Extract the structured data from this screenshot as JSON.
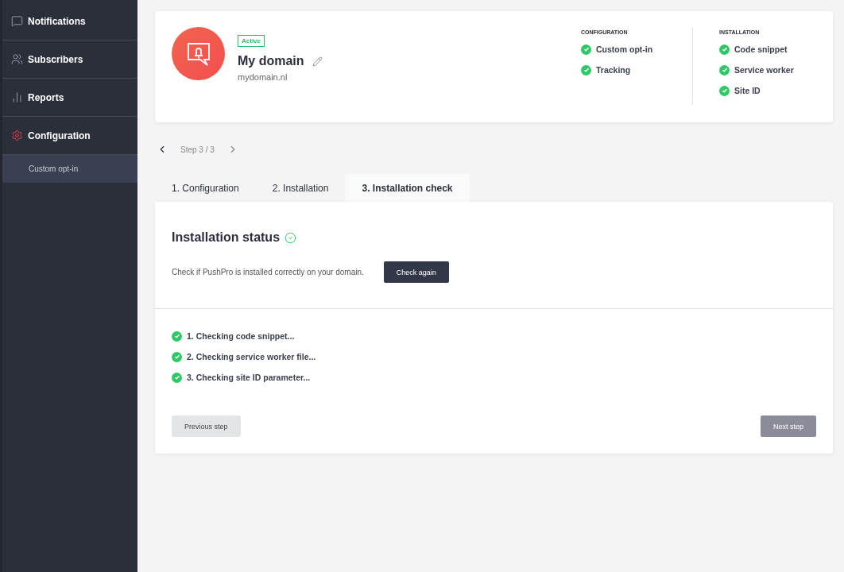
{
  "sidebar": {
    "items": [
      {
        "label": "Notifications",
        "kind": "message",
        "selected": false
      },
      {
        "label": "Subscribers",
        "kind": "users",
        "selected": false
      },
      {
        "label": "Reports",
        "kind": "chart",
        "selected": false
      },
      {
        "label": "Configuration",
        "kind": "gear",
        "selected": true,
        "children": [
          {
            "label": "Custom opt-in",
            "selected": true
          }
        ]
      }
    ]
  },
  "domain": {
    "status": "Active",
    "name": "My domain",
    "url": "mydomain.nl",
    "summary": [
      {
        "heading": "CONFIGURATION",
        "items": [
          {
            "label": "Custom opt-in",
            "checked": true
          },
          {
            "label": "Tracking",
            "checked": true
          }
        ]
      },
      {
        "heading": "INSTALLATION",
        "items": [
          {
            "label": "Code snippet",
            "checked": true
          },
          {
            "label": "Service worker",
            "checked": true
          },
          {
            "label": "Site ID",
            "checked": true
          }
        ]
      }
    ]
  },
  "stepper": {
    "label": "Step 3 / 3"
  },
  "tabs": [
    {
      "label": "1. Configuration",
      "selected": false
    },
    {
      "label": "2. Installation",
      "selected": false
    },
    {
      "label": "3. Installation check",
      "selected": true
    }
  ],
  "status": {
    "title": "Installation status",
    "ok": true,
    "description": "Check if PushPro is installed correctly on your domain.",
    "button": "Check again",
    "checks": [
      {
        "label": "1. Checking code snippet...",
        "checked": true
      },
      {
        "label": "2. Checking service worker file...",
        "checked": true
      },
      {
        "label": "3. Checking site ID parameter...",
        "checked": true
      }
    ]
  },
  "footer": {
    "previous": {
      "label": "Previous step",
      "disabled": false
    },
    "next": {
      "label": "Next step",
      "disabled": true
    }
  }
}
